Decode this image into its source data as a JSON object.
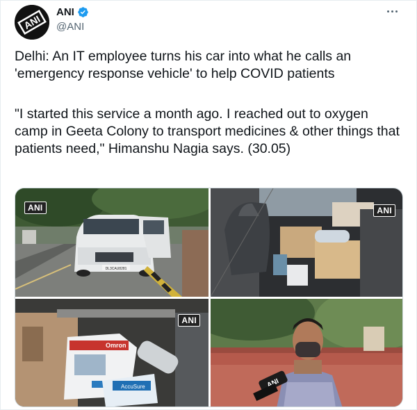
{
  "tweet": {
    "display_name": "ANI",
    "handle": "@ANI",
    "avatar_text": "ANI",
    "verified": true,
    "paragraphs": [
      "Delhi: An IT employee turns his car into what he calls an 'emergency response vehicle' to help COVID patients",
      "\"I started this service a month ago. I reached out to oxygen camp in Geeta Colony to transport medicines & other things that patients need,\" Himanshu Nagia says. (30.05)"
    ],
    "media": [
      {
        "watermark": "ANI",
        "plate_text": "DL3CAU8281"
      },
      {
        "watermark": "ANI"
      },
      {
        "watermark": "ANI",
        "box_text_1": "Omron",
        "box_text_2": "AccuSure"
      },
      {
        "mic_text": "ANI"
      }
    ]
  },
  "colors": {
    "text": "#0f1419",
    "secondary": "#536471",
    "verified": "#1d9bf0",
    "border": "#cfd9de"
  }
}
